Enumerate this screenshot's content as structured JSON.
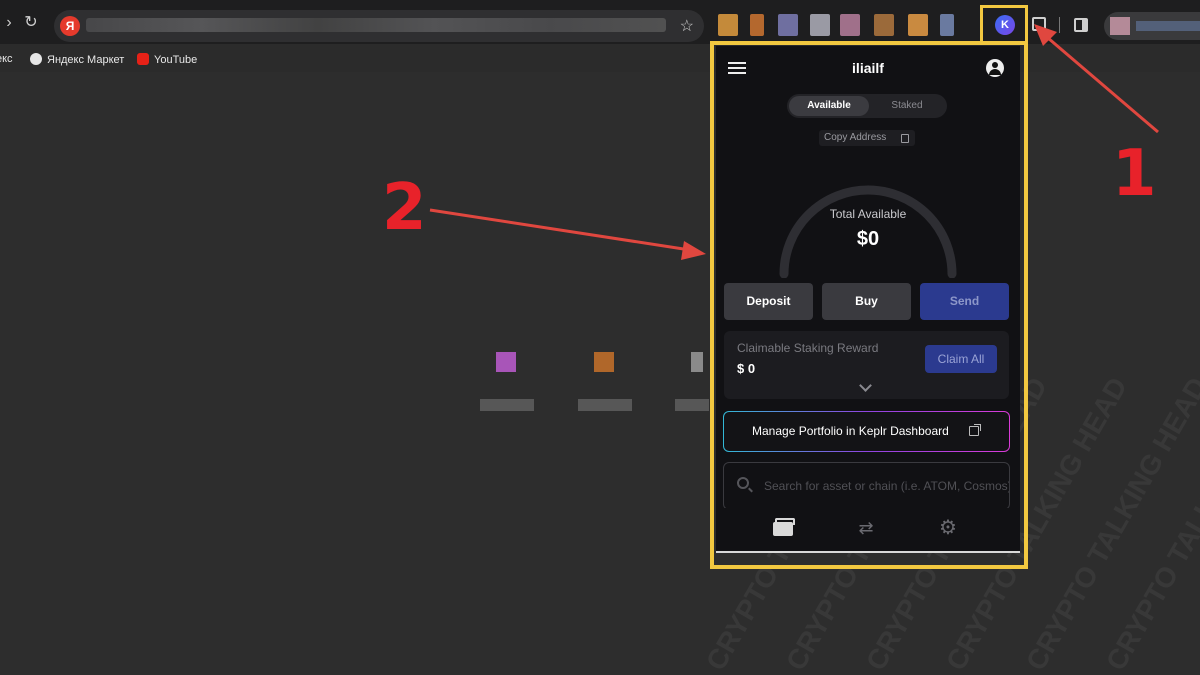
{
  "browser": {
    "yandex_icon": "Я",
    "bookmarks": [
      {
        "label": "екс",
        "icon": "folder-icon"
      },
      {
        "label": "Яндекс Маркет",
        "icon": "globe-icon"
      },
      {
        "label": "YouTube",
        "icon": "youtube-icon"
      }
    ],
    "keplr_icon_letter": "K"
  },
  "annotations": {
    "one": "1",
    "two": "2",
    "highlight_color": "#f2c840",
    "arrow_color": "#e0473f"
  },
  "popup": {
    "account_name": "iliailf",
    "tabs": {
      "available": "Available",
      "staked": "Staked"
    },
    "copy_address": "Copy Address",
    "total_label": "Total Available",
    "total_value": "$0",
    "buttons": {
      "deposit": "Deposit",
      "buy": "Buy",
      "send": "Send"
    },
    "reward": {
      "label": "Claimable Staking Reward",
      "value": "$ 0",
      "claim": "Claim All"
    },
    "manage": "Manage Portfolio in Keplr Dashboard",
    "search_placeholder": "Search for asset or chain (i.e. ATOM, Cosmos)",
    "nav_icons": [
      "wallet-icon",
      "swap-icon",
      "gear-icon"
    ]
  },
  "watermark": "CRYPTO TALKING HEAD"
}
